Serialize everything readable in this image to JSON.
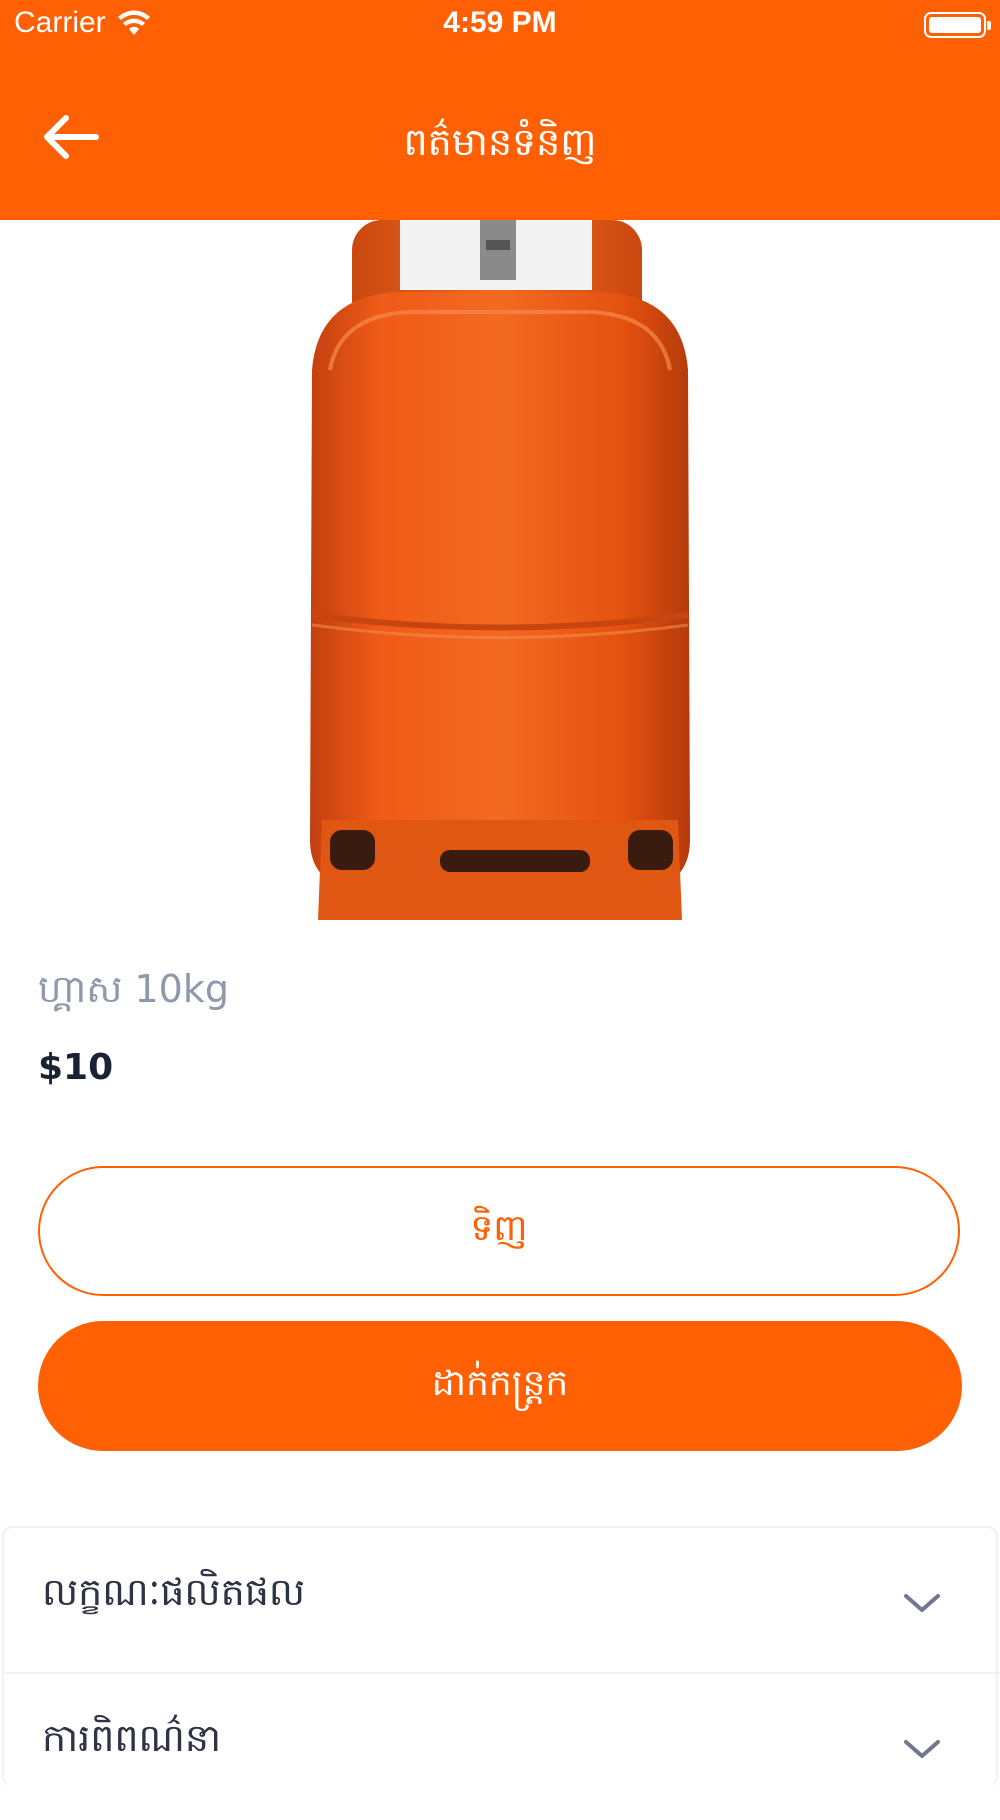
{
  "status_bar": {
    "carrier": "Carrier",
    "time": "4:59 PM"
  },
  "header": {
    "title": "ពត៌មានទំនិញ",
    "back_icon": "arrow-left-icon"
  },
  "product": {
    "image": "gas-cylinder-image",
    "name": "ហ្គាស 10kg",
    "price": "$10"
  },
  "actions": {
    "buy_label": "ទិញ",
    "add_to_cart_label": "ដាក់កន្ត្រក"
  },
  "sections": [
    {
      "label": "លក្ខណៈផលិតផល",
      "icon": "chevron-down-icon"
    },
    {
      "label": "ការពិពណ៌នា",
      "icon": "chevron-down-icon"
    }
  ],
  "colors": {
    "accent": "#ff6003",
    "price_text": "#1b2233",
    "name_text": "#8e99ad"
  }
}
